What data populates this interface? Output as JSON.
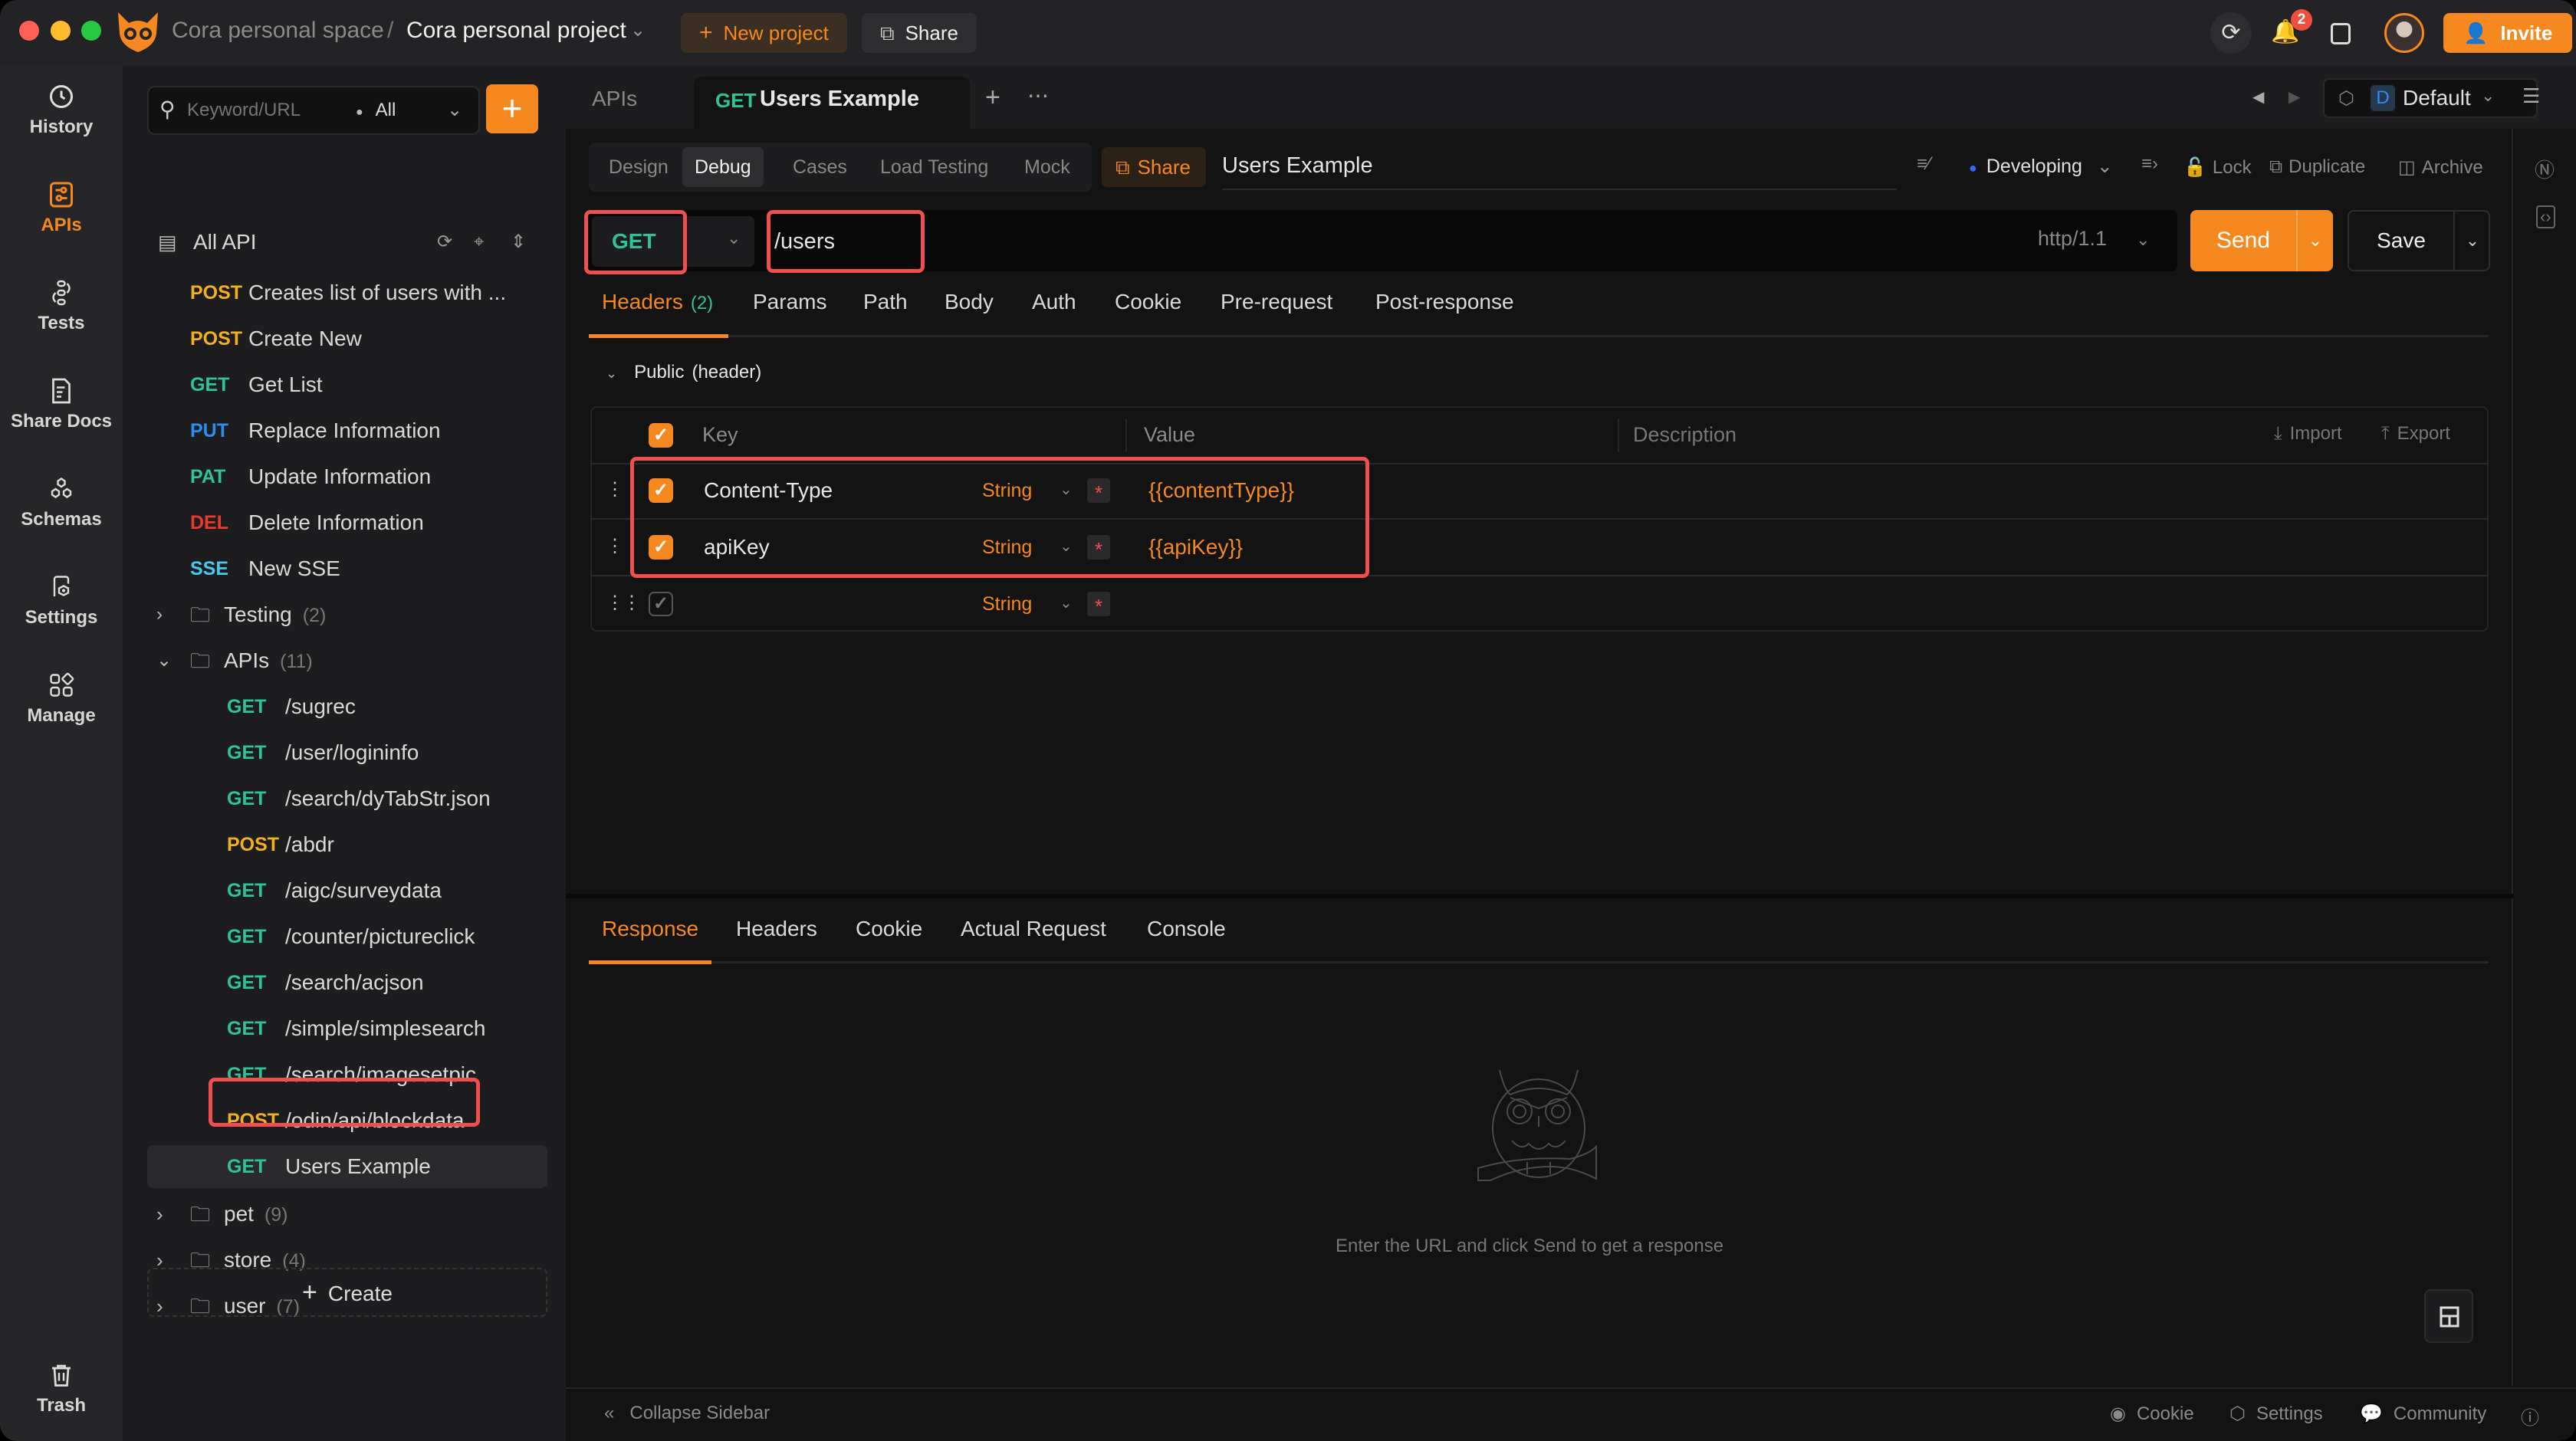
{
  "titlebar": {
    "workspace": "Cora personal space",
    "separator": "/",
    "project": "Cora personal project",
    "new_project_label": "New project",
    "share_label": "Share",
    "notifications_count": "2",
    "invite_label": "Invite"
  },
  "rail": {
    "items": [
      {
        "label": "History",
        "icon": "history-icon",
        "active": false
      },
      {
        "label": "APIs",
        "icon": "apis-icon",
        "active": true
      },
      {
        "label": "Tests",
        "icon": "tests-icon",
        "active": false
      },
      {
        "label": "Share Docs",
        "icon": "share-docs-icon",
        "active": false
      },
      {
        "label": "Schemas",
        "icon": "schemas-icon",
        "active": false
      },
      {
        "label": "Settings",
        "icon": "settings-icon",
        "active": false
      },
      {
        "label": "Manage",
        "icon": "manage-icon",
        "active": false
      }
    ],
    "trash_label": "Trash"
  },
  "sidebar": {
    "search_placeholder": "Keyword/URL",
    "filter_value": "All",
    "all_api_label": "All API",
    "root_items": [
      {
        "method": "POST",
        "name": "Creates list of users with ..."
      },
      {
        "method": "POST",
        "name": "Create New"
      },
      {
        "method": "GET",
        "name": "Get List"
      },
      {
        "method": "PUT",
        "name": "Replace Information"
      },
      {
        "method": "PAT",
        "name": "Update Information"
      },
      {
        "method": "DEL",
        "name": "Delete Information"
      },
      {
        "method": "SSE",
        "name": "New SSE"
      }
    ],
    "folders_top": [
      {
        "name": "Testing",
        "count": "(2)",
        "expanded": false
      },
      {
        "name": "APIs",
        "count": "(11)",
        "expanded": true
      }
    ],
    "api_folder_items": [
      {
        "method": "GET",
        "name": "/sugrec"
      },
      {
        "method": "GET",
        "name": "/user/logininfo"
      },
      {
        "method": "GET",
        "name": "/search/dyTabStr.json"
      },
      {
        "method": "POST",
        "name": "/abdr"
      },
      {
        "method": "GET",
        "name": "/aigc/surveydata"
      },
      {
        "method": "GET",
        "name": "/counter/pictureclick"
      },
      {
        "method": "GET",
        "name": "/search/acjson"
      },
      {
        "method": "GET",
        "name": "/simple/simplesearch"
      },
      {
        "method": "GET",
        "name": "/search/imagesetpic"
      },
      {
        "method": "POST",
        "name": "/odin/api/blockdata"
      },
      {
        "method": "GET",
        "name": "Users Example",
        "selected": true
      }
    ],
    "folders_bottom": [
      {
        "name": "pet",
        "count": "(9)"
      },
      {
        "name": "store",
        "count": "(4)"
      },
      {
        "name": "user",
        "count": "(7)"
      }
    ],
    "create_label": "Create"
  },
  "tabs": {
    "apis_label": "APIs",
    "active_method": "GET",
    "active_title": "Users Example",
    "env_badge": "D",
    "env_name": "Default"
  },
  "mode_tabs": [
    "Design",
    "Debug",
    "Cases",
    "Load Testing",
    "Mock"
  ],
  "mode_active": "Debug",
  "toolbar": {
    "share_label": "Share",
    "api_name": "Users Example",
    "status_label": "Developing",
    "status_color": "#2d6bf2",
    "lock_label": "Lock",
    "duplicate_label": "Duplicate",
    "archive_label": "Archive"
  },
  "request": {
    "method": "GET",
    "url": "/users",
    "protocol": "http/1.1",
    "send_label": "Send",
    "save_label": "Save"
  },
  "req_tabs": [
    {
      "label": "Headers",
      "badge": "(2)",
      "active": true
    },
    {
      "label": "Params"
    },
    {
      "label": "Path"
    },
    {
      "label": "Body"
    },
    {
      "label": "Auth"
    },
    {
      "label": "Cookie"
    },
    {
      "label": "Pre-request"
    },
    {
      "label": "Post-response"
    }
  ],
  "public_header_label": "Public",
  "public_header_suffix": "(header)",
  "headers_table": {
    "columns": [
      "Key",
      "Value",
      "Description"
    ],
    "import_label": "Import",
    "export_label": "Export",
    "rows": [
      {
        "enabled": true,
        "key": "Content-Type",
        "type": "String",
        "value": "{{contentType}}"
      },
      {
        "enabled": true,
        "key": "apiKey",
        "type": "String",
        "value": "{{apiKey}}"
      },
      {
        "enabled": false,
        "key": "",
        "type": "String",
        "value": ""
      }
    ]
  },
  "resp_tabs": [
    "Response",
    "Headers",
    "Cookie",
    "Actual Request",
    "Console"
  ],
  "resp_active": "Response",
  "empty_state": "Enter the URL and click Send to get a response",
  "footer": {
    "collapse_label": "Collapse Sidebar",
    "cookie_label": "Cookie",
    "settings_label": "Settings",
    "community_label": "Community"
  },
  "colors": {
    "accent": "#f5891f",
    "get": "#2fc496",
    "post": "#f2b01e",
    "put": "#2d8ef2",
    "del": "#e83a30",
    "sse": "#49c8ee",
    "highlight": "#ef4f4f"
  }
}
